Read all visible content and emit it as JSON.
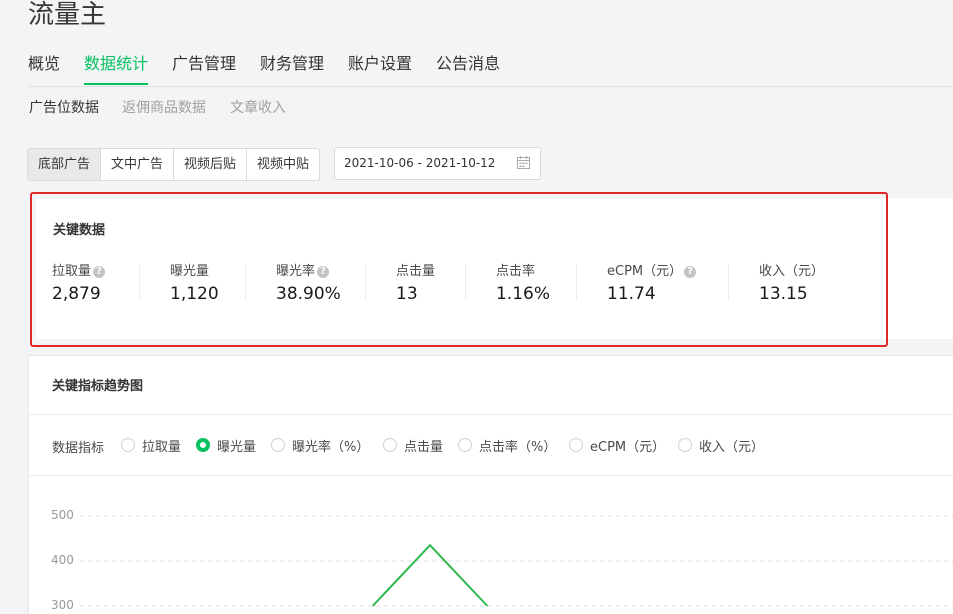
{
  "app": {
    "title": "流量主"
  },
  "nav": {
    "items": [
      {
        "label": "概览"
      },
      {
        "label": "数据统计"
      },
      {
        "label": "广告管理"
      },
      {
        "label": "财务管理"
      },
      {
        "label": "账户设置"
      },
      {
        "label": "公告消息"
      }
    ],
    "active_index": 1
  },
  "subnav": {
    "items": [
      {
        "label": "广告位数据"
      },
      {
        "label": "返佣商品数据"
      },
      {
        "label": "文章收入"
      }
    ],
    "active_index": 0
  },
  "ad_types": {
    "items": [
      {
        "label": "底部广告"
      },
      {
        "label": "文中广告"
      },
      {
        "label": "视频后贴"
      },
      {
        "label": "视频中贴"
      }
    ],
    "active_index": 0
  },
  "date_range": {
    "value": "2021-10-06 - 2021-10-12",
    "icon": "calendar-icon"
  },
  "key_data": {
    "title": "关键数据",
    "metrics": [
      {
        "label": "拉取量",
        "value": "2,879",
        "has_help": true
      },
      {
        "label": "曝光量",
        "value": "1,120",
        "has_help": false
      },
      {
        "label": "曝光率",
        "value": "38.90%",
        "has_help": true
      },
      {
        "label": "点击量",
        "value": "13",
        "has_help": false
      },
      {
        "label": "点击率",
        "value": "1.16%",
        "has_help": false
      },
      {
        "label": "eCPM（元）",
        "value": "11.74",
        "has_help": true
      },
      {
        "label": "收入（元）",
        "value": "13.15",
        "has_help": false
      }
    ]
  },
  "trend": {
    "title": "关键指标趋势图",
    "indicator_label": "数据指标",
    "options": [
      {
        "label": "拉取量"
      },
      {
        "label": "曝光量"
      },
      {
        "label": "曝光率（%）"
      },
      {
        "label": "点击量"
      },
      {
        "label": "点击率（%）"
      },
      {
        "label": "eCPM（元）"
      },
      {
        "label": "收入（元）"
      }
    ],
    "selected_index": 1
  },
  "chart_data": {
    "type": "line",
    "title": "",
    "xlabel": "",
    "ylabel": "",
    "yticks": [
      "500",
      "400",
      "300"
    ],
    "series": [
      {
        "values": [
          {
            "x": 4.3,
            "y": 300
          },
          {
            "x": 5,
            "y": 435
          },
          {
            "x": 5.7,
            "y": 300
          }
        ]
      }
    ],
    "line_color": "#2db84d",
    "grid": true
  },
  "colors": {
    "accent": "#07c160",
    "highlight_box": "#e02828"
  }
}
